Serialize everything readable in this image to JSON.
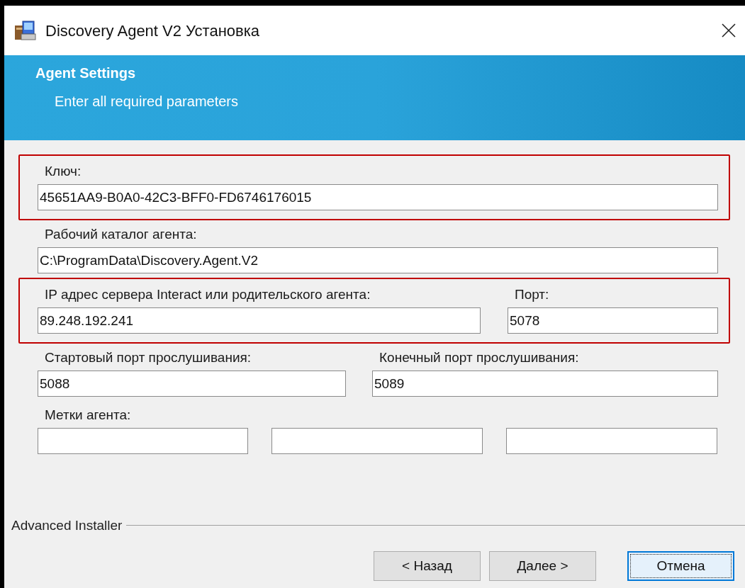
{
  "window": {
    "title": "Discovery Agent V2 Установка"
  },
  "header": {
    "title": "Agent Settings",
    "subtitle": "Enter all required parameters"
  },
  "rows": [
    {
      "highlighted": true,
      "fields": [
        {
          "kind": "input",
          "label": "Ключ:",
          "value": "45651AA9-B0A0-42C3-BFF0-FD6746176015"
        }
      ]
    },
    {
      "highlighted": false,
      "fields": [
        {
          "kind": "input",
          "label": "Рабочий каталог агента:",
          "value": "C:\\ProgramData\\Discovery.Agent.V2"
        }
      ]
    },
    {
      "highlighted": true,
      "fields": [
        {
          "kind": "input",
          "label": "IP адрес сервера Interact или родительского агента:",
          "value": "89.248.192.241"
        },
        {
          "kind": "input",
          "label": "Порт:",
          "value": "5078"
        }
      ]
    },
    {
      "highlighted": false,
      "fields": [
        {
          "kind": "input",
          "label": "Стартовый порт прослушивания:",
          "value": "5088"
        },
        {
          "kind": "input",
          "label": "Конечный порт прослушивания:",
          "value": "5089"
        }
      ]
    },
    {
      "highlighted": false,
      "fields": [
        {
          "kind": "input",
          "label": "Метки агента:"
        },
        {
          "kind": "input"
        },
        {
          "kind": "input"
        }
      ]
    }
  ],
  "footer": {
    "brand": "Advanced Installer",
    "buttons": [
      {
        "label": "< Назад",
        "focused": false
      },
      {
        "label": "Далее >",
        "focused": false
      },
      {
        "label": "Отмена",
        "focused": true
      }
    ]
  }
}
